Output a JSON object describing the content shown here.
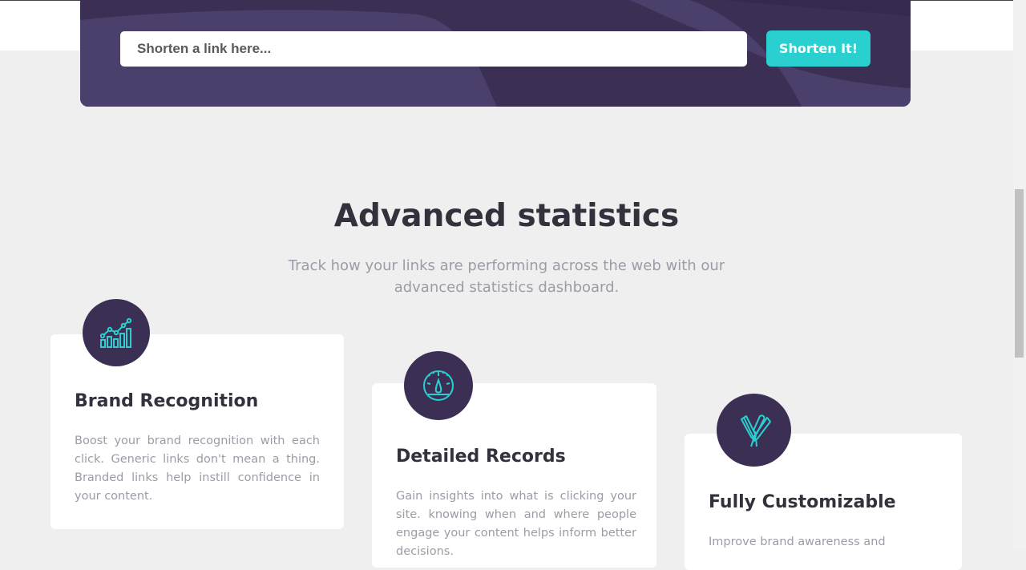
{
  "shorten": {
    "placeholder": "Shorten a link here...",
    "button_label": "Shorten It!"
  },
  "stats": {
    "title": "Advanced statistics",
    "subtitle": "Track how your links are performing across the web with our advanced statistics dashboard.",
    "cards": [
      {
        "icon": "brand-recognition-icon",
        "title": "Brand Recognition",
        "text": "Boost your brand recognition with each click. Generic links don't mean a thing. Branded links help instill confidence in your content."
      },
      {
        "icon": "detailed-records-icon",
        "title": "Detailed Records",
        "text": "Gain insights into what is clicking your site. knowing when and where people engage your content helps inform better decisions."
      },
      {
        "icon": "fully-customizable-icon",
        "title": "Fully Customizable",
        "text": "Improve brand awareness and"
      }
    ]
  },
  "colors": {
    "primary": "#2acfcf",
    "dark_violet": "#3b3054",
    "grayish_violet": "#9e9aa7",
    "very_dark_blue": "#34313d",
    "background": "#efefef"
  }
}
